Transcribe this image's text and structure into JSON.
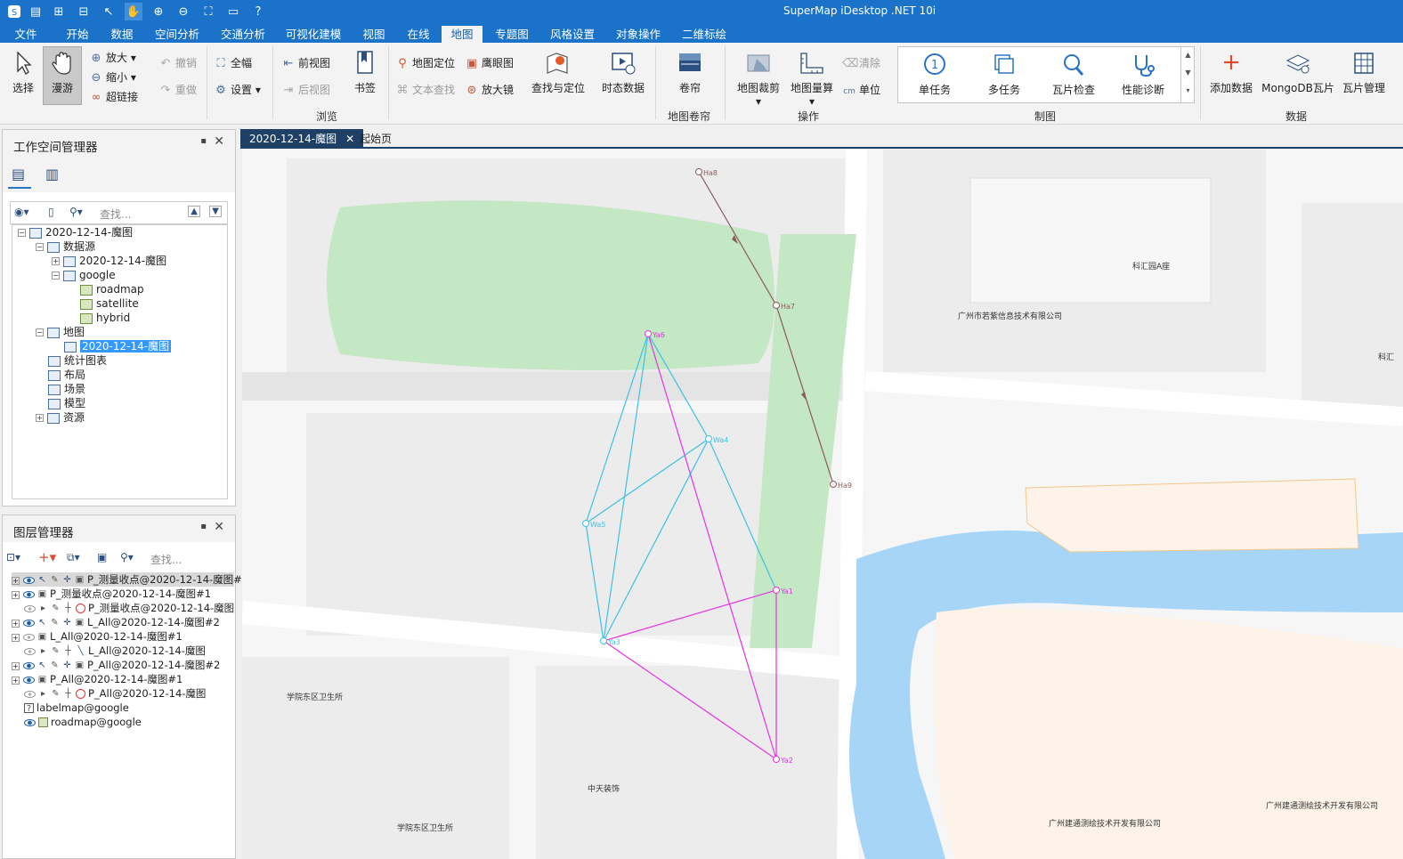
{
  "app": {
    "title": "SuperMap iDesktop .NET 10i"
  },
  "menu_tabs": [
    "文件",
    "开始",
    "数据",
    "空间分析",
    "交通分析",
    "可视化建模",
    "视图",
    "在线",
    "地图",
    "专题图",
    "风格设置",
    "对象操作",
    "二维标绘"
  ],
  "active_menu_tab": "地图",
  "ribbon": {
    "select": "选择",
    "pan": "漫游",
    "zoom_in": "放大",
    "zoom_out": "缩小",
    "hyperlink": "超链接",
    "undo": "撤销",
    "redo": "重做",
    "full_extent": "全幅",
    "settings": "设置",
    "prev_view": "前视图",
    "next_view": "后视图",
    "bookmark": "书签",
    "map_locate": "地图定位",
    "text_search": "文本查找",
    "eagle_eye": "鹰眼图",
    "magnifier": "放大镜",
    "find_locate": "查找与定位",
    "time_data": "时态数据",
    "browse_group": "浏览",
    "swipe": "卷帘",
    "swipe_group": "地图卷帘",
    "map_clip": "地图裁剪",
    "map_measure": "地图量算",
    "clear": "清除",
    "unit": "单位",
    "operate_group": "操作",
    "single_task": "单任务",
    "multi_task": "多任务",
    "tile_check": "瓦片检查",
    "perf_diag": "性能诊断",
    "mapping_group": "制图",
    "add_data": "添加数据",
    "mongodb_tiles": "MongoDB瓦片",
    "tile_manage": "瓦片管理",
    "data_group": "数据"
  },
  "workspace": {
    "title": "工作空间管理器",
    "search_placeholder": "查找...",
    "tree": {
      "root": "2020-12-14-魔图",
      "datasources": "数据源",
      "ds1": "2020-12-14-魔图",
      "ds2": "google",
      "ds2_children": [
        "roadmap",
        "satellite",
        "hybrid"
      ],
      "maps": "地图",
      "map1": "2020-12-14-魔图",
      "charts": "统计图表",
      "layouts": "布局",
      "scenes": "场景",
      "models": "模型",
      "resources": "资源"
    }
  },
  "layers": {
    "title": "图层管理器",
    "search_placeholder": "查找...",
    "items": [
      "P_测量收点@2020-12-14-魔图#",
      "P_测量收点@2020-12-14-魔图#1",
      "P_测量收点@2020-12-14-魔图",
      "L_All@2020-12-14-魔图#2",
      "L_All@2020-12-14-魔图#1",
      "L_All@2020-12-14-魔图",
      "P_All@2020-12-14-魔图#2",
      "P_All@2020-12-14-魔图#1",
      "P_All@2020-12-14-魔图",
      "labelmap@google",
      "roadmap@google"
    ]
  },
  "doc_tabs": [
    "2020-12-14-魔图",
    "起始页"
  ],
  "map": {
    "place_labels": [
      "科汇园A座",
      "广州市若紫信息技术有限公司",
      "科汇",
      "学院东区卫生所",
      "中天装饰",
      "学院东区卫生所",
      "广州建通测绘技术开发有限公司",
      "广州建通测绘技术开发有限公司"
    ],
    "points": {
      "ha8": "Ha8",
      "ha7": "Ha7",
      "ha9": "Ha9",
      "ya6": "Ya6",
      "ya1": "Ya1",
      "ya2": "Ya2",
      "ya3": "Ya3",
      "wa4": "Wa4",
      "wa5": "Wa5"
    },
    "colors": {
      "brown": "#8b5a5a",
      "cyan": "#3cc0e6",
      "magenta": "#e632e6",
      "water": "#a7d5f7",
      "park": "#c4e7c4"
    }
  }
}
